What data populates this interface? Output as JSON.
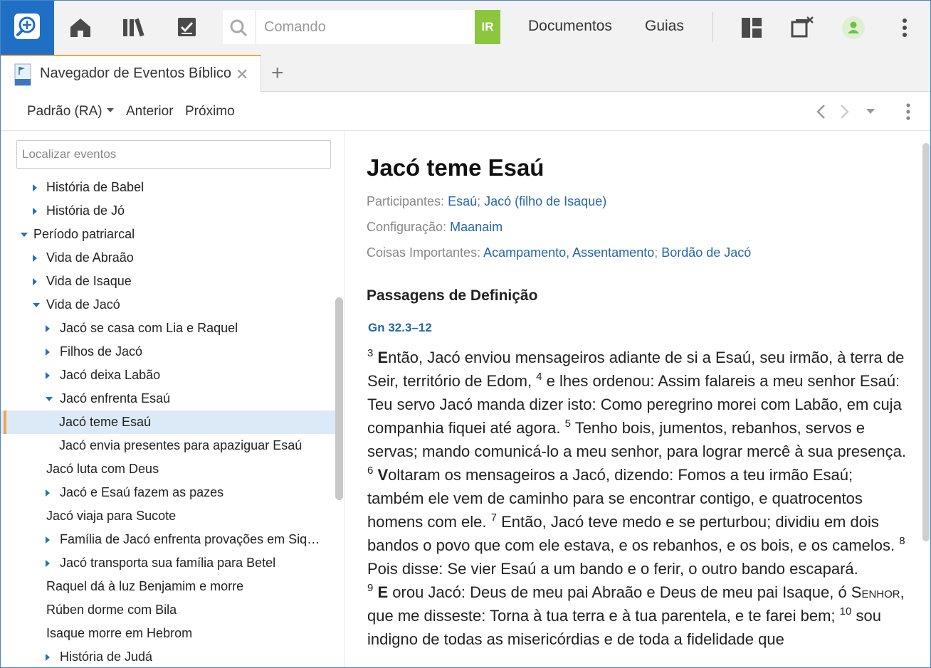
{
  "topbar": {
    "logo_icon": "logos-search-icon",
    "icons": [
      "home-icon",
      "library-icon",
      "checklist-icon"
    ],
    "command_placeholder": "Comando",
    "go_label": "IR",
    "nav": [
      "Documentos",
      "Guias"
    ],
    "right_icons": [
      "layout-icon",
      "close-panels-icon",
      "user-avatar-icon",
      "more-vertical-icon"
    ],
    "accent": "#1f6fc4",
    "go_color": "#8cc63f"
  },
  "tab": {
    "title": "Navegador de Eventos Bíblico",
    "close": "✕",
    "add": "+"
  },
  "panel_toolbar": {
    "version": "Padrão (RA)",
    "previous": "Anterior",
    "next": "Próximo"
  },
  "left": {
    "search_placeholder": "Localizar eventos",
    "tree": [
      {
        "label": "História de Babel",
        "level": 1,
        "arrow": "right"
      },
      {
        "label": "História de Jó",
        "level": 1,
        "arrow": "right"
      },
      {
        "label": "Período patriarcal",
        "level": 0,
        "arrow": "down"
      },
      {
        "label": "Vida de Abraão",
        "level": 1,
        "arrow": "right"
      },
      {
        "label": "Vida de Isaque",
        "level": 1,
        "arrow": "right"
      },
      {
        "label": "Vida de Jacó",
        "level": 1,
        "arrow": "down"
      },
      {
        "label": "Jacó se casa com Lia e Raquel",
        "level": 2,
        "arrow": "right"
      },
      {
        "label": "Filhos de Jacó",
        "level": 2,
        "arrow": "right"
      },
      {
        "label": "Jacó deixa Labão",
        "level": 2,
        "arrow": "right"
      },
      {
        "label": "Jacó enfrenta Esaú",
        "level": 2,
        "arrow": "down"
      },
      {
        "label": "Jacó teme Esaú",
        "level": 3,
        "arrow": "none",
        "selected": true
      },
      {
        "label": "Jacó envia presentes para apaziguar Esaú",
        "level": 3,
        "arrow": "none"
      },
      {
        "label": "Jacó luta com Deus",
        "level": 1.5,
        "arrow": "none"
      },
      {
        "label": "Jacó e Esaú fazem as pazes",
        "level": 2,
        "arrow": "right"
      },
      {
        "label": "Jacó viaja para Sucote",
        "level": 1.5,
        "arrow": "none"
      },
      {
        "label": "Família de Jacó enfrenta provações em Siquém",
        "level": 2,
        "arrow": "right"
      },
      {
        "label": "Jacó transporta sua família para Betel",
        "level": 2,
        "arrow": "right"
      },
      {
        "label": "Raquel dá à luz Benjamim e morre",
        "level": 1.5,
        "arrow": "none"
      },
      {
        "label": "Rúben dorme com Bila",
        "level": 1.5,
        "arrow": "none"
      },
      {
        "label": "Isaque morre em Hebrom",
        "level": 1.5,
        "arrow": "none"
      },
      {
        "label": "História de Judá",
        "level": 2,
        "arrow": "right"
      }
    ]
  },
  "article": {
    "title": "Jacó teme Esaú",
    "participants_label": "Participantes: ",
    "participants": [
      "Esaú",
      "Jacó (filho de Isaque)"
    ],
    "config_label": "Configuração: ",
    "config": "Maanaim",
    "things_label": "Coisas Importantes: ",
    "things": [
      "Acampamento, Assentamento",
      "Bordão de Jacó"
    ],
    "section_title": "Passagens de Definição",
    "reference": "Gn 32.3–12",
    "verses": {
      "v3": "3",
      "v3_drop": "E",
      "v3_text": "ntão, Jacó enviou mensageiros adiante de si a Esaú, seu irmão, à terra de Seir, território de Edom, ",
      "v4": "4",
      "v4_text": " e lhes ordenou: Assim falareis a meu senhor Esaú: Teu servo Jacó manda dizer isto: Como peregrino morei com Labão, em cuja companhia fiquei até agora. ",
      "v5": "5",
      "v5_text": " Tenho bois, jumentos, rebanhos, servos e servas; mando comunicá-lo a meu senhor, para lograr mercê à sua presença.",
      "v6": "6",
      "v6_drop": "V",
      "v6_text": "oltaram os mensageiros a Jacó, dizendo: Fomos a teu irmão Esaú; também ele vem de caminho para se encontrar contigo, e quatrocentos homens com ele. ",
      "v7": "7",
      "v7_text": " Então, Jacó teve medo e se perturbou; dividiu em dois bandos o povo que com ele estava, e os rebanhos, e os bois, e os camelos. ",
      "v8": "8",
      "v8_text": " Pois disse: Se vier Esaú a um bando e o ferir, o outro bando escapará.",
      "v9": "9",
      "v9_drop": "E",
      "v9_text": " orou Jacó: Deus de meu pai Abraão e Deus de meu pai Isaque, ó ",
      "v9_lord": "Senhor",
      "v9_text2": ", que me disseste: Torna à tua terra e à tua parentela, e te farei bem; ",
      "v10": "10",
      "v10_text": " sou indigno de todas as misericórdias e de toda a fidelidade que"
    }
  }
}
